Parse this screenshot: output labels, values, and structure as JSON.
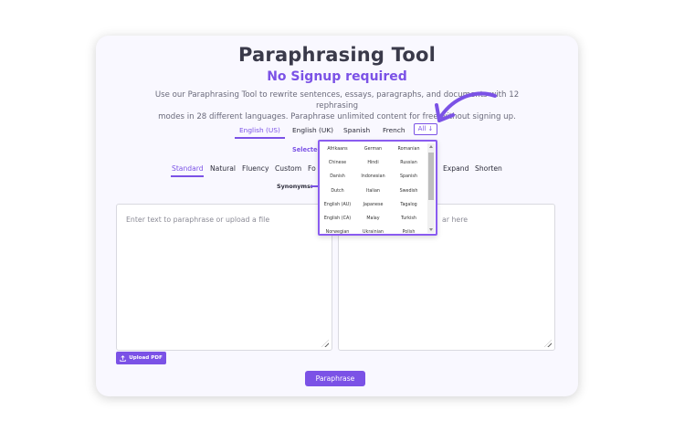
{
  "header": {
    "title": "Paraphrasing Tool",
    "subtitle": "No Signup required",
    "description_line1": "Use our Paraphrasing Tool to rewrite sentences, essays, paragraphs, and documents with 12 rephrasing",
    "description_line2": "modes in 28 different languages. Paraphrase unlimited content for free without signing up."
  },
  "language_tabs": [
    {
      "label": "English (US)",
      "active": true
    },
    {
      "label": "English (UK)",
      "active": false
    },
    {
      "label": "Spanish",
      "active": false
    },
    {
      "label": "French",
      "active": false
    }
  ],
  "all_button": {
    "label": "All ↓"
  },
  "selected_label": "Selected",
  "modes": [
    {
      "label": "Standard",
      "active": true
    },
    {
      "label": "Natural",
      "active": false
    },
    {
      "label": "Fluency",
      "active": false
    },
    {
      "label": "Custom",
      "active": false
    },
    {
      "label": "Fo",
      "active": false
    },
    {
      "label": "Expand",
      "active": false
    },
    {
      "label": "Shorten",
      "active": false
    }
  ],
  "synonyms_label": "Synonyms:",
  "input_box": {
    "placeholder": "Enter text to paraphrase or upload a file"
  },
  "output_box": {
    "placeholder": "ar here"
  },
  "upload_button": {
    "label": "Upload PDF"
  },
  "paraphrase_button": {
    "label": "Paraphrase"
  },
  "language_dropdown": {
    "items": [
      "Afrikaans",
      "German",
      "Romanian",
      "Chinese",
      "Hindi",
      "Russian",
      "Danish",
      "Indonesian",
      "Spanish",
      "Dutch",
      "Italian",
      "Swedish",
      "English (AU)",
      "Japanese",
      "Tagalog",
      "English (CA)",
      "Malay",
      "Turkish",
      "Norwegian",
      "Ukrainian",
      "Polish"
    ]
  },
  "colors": {
    "accent": "#7b52e6",
    "card_bg": "#f9f8ff",
    "text": "#2c2c3a"
  }
}
